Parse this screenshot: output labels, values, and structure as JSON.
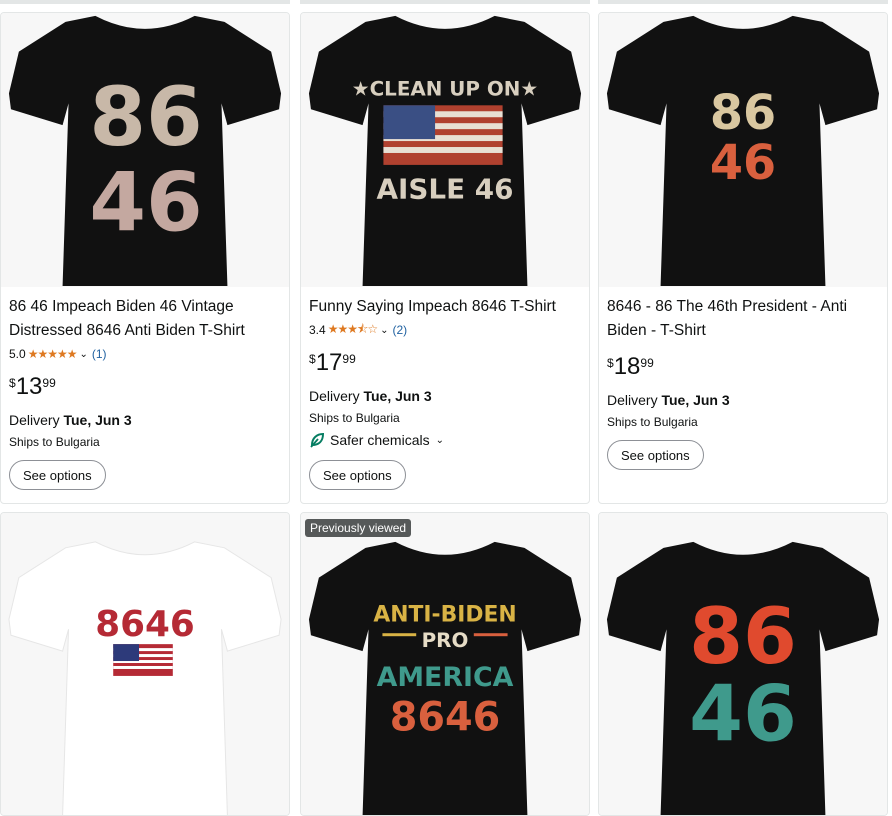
{
  "products": [
    {
      "title": "86 46 Impeach Biden 46 Vintage Distressed 8646 Anti Biden T-Shirt",
      "rating": "5.0",
      "stars": "★★★★★",
      "review_count": "(1)",
      "price": {
        "symbol": "$",
        "whole": "13",
        "fraction": "99"
      },
      "delivery_prefix": "Delivery ",
      "delivery_date": "Tue, Jun 3",
      "ships_to": "Ships to Bulgaria",
      "button_label": "See options",
      "design_text": [
        "86",
        "46"
      ]
    },
    {
      "title": "Funny Saying Impeach 8646 T-Shirt",
      "rating": "3.4",
      "stars": "★★★⯪☆",
      "review_count": "(2)",
      "price": {
        "symbol": "$",
        "whole": "17",
        "fraction": "99"
      },
      "delivery_prefix": "Delivery ",
      "delivery_date": "Tue, Jun 3",
      "ships_to": "Ships to Bulgaria",
      "safer_label": "Safer chemicals",
      "button_label": "See options",
      "design_text": [
        "★CLEAN UP ON★",
        "AISLE 46"
      ]
    },
    {
      "title": "8646 - 86 The 46th President - Anti Biden - T-Shirt",
      "price": {
        "symbol": "$",
        "whole": "18",
        "fraction": "99"
      },
      "delivery_prefix": "Delivery ",
      "delivery_date": "Tue, Jun 3",
      "ships_to": "Ships to Bulgaria",
      "button_label": "See options",
      "design_text": [
        "86",
        "46"
      ]
    },
    {
      "design_text": [
        "8646"
      ]
    },
    {
      "badge": "Previously viewed",
      "design_text": [
        "ANTI-BIDEN",
        "PRO",
        "AMERICA",
        "8646"
      ]
    },
    {
      "design_text": [
        "86",
        "46"
      ]
    }
  ],
  "colors": {
    "star": "#de7921",
    "link": "#2162a1",
    "shirt_dark": "#111111",
    "shirt_white": "#ffffff",
    "safer_green": "#067d62"
  }
}
